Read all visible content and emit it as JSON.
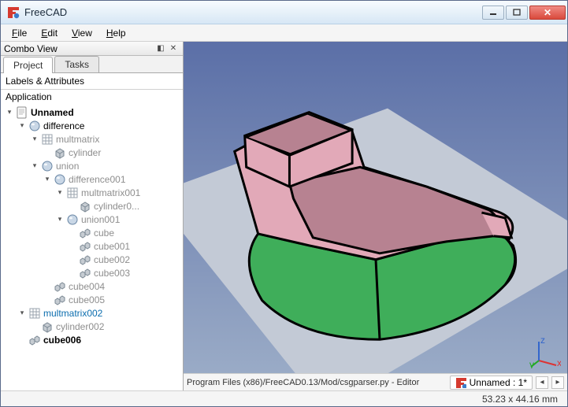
{
  "window": {
    "title": "FreeCAD"
  },
  "menu": {
    "file": "File",
    "edit": "Edit",
    "view": "View",
    "help": "Help"
  },
  "dock": {
    "title": "Combo View"
  },
  "tabs": {
    "project": "Project",
    "tasks": "Tasks"
  },
  "section": {
    "labels": "Labels & Attributes",
    "application": "Application"
  },
  "tree": {
    "unnamed": "Unnamed",
    "difference": "difference",
    "multmatrix": "multmatrix",
    "cylinder": "cylinder",
    "union": "union",
    "difference001": "difference001",
    "multmatrix001": "multmatrix001",
    "cylinder0": "cylinder0...",
    "union001": "union001",
    "cube": "cube",
    "cube001": "cube001",
    "cube002": "cube002",
    "cube003": "cube003",
    "cube004": "cube004",
    "cube005": "cube005",
    "multmatrix002": "multmatrix002",
    "cylinder002": "cylinder002",
    "cube006": "cube006"
  },
  "status": {
    "path": "Program Files (x86)/FreeCAD0.13/Mod/csgparser.py - Editor",
    "docname": "Unnamed : 1*",
    "coords": "53.23 x 44.16 mm"
  },
  "axis": {
    "x": "x",
    "y": "y",
    "z": "z"
  }
}
